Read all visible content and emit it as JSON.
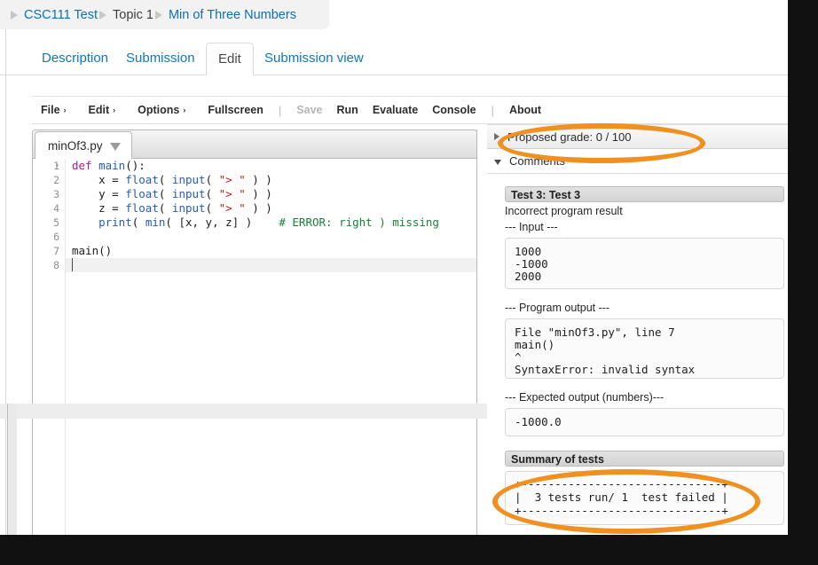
{
  "breadcrumb": {
    "items": [
      {
        "label": "CSC111 Test",
        "type": "link"
      },
      {
        "label": "Topic 1",
        "type": "current"
      },
      {
        "label": "Min of Three Numbers",
        "type": "link"
      }
    ]
  },
  "tabs": [
    {
      "label": "Description",
      "active": false
    },
    {
      "label": "Submission",
      "active": false
    },
    {
      "label": "Edit",
      "active": true
    },
    {
      "label": "Submission view",
      "active": false
    }
  ],
  "toolbar": {
    "file": "File",
    "edit": "Edit",
    "options": "Options",
    "fullscreen": "Fullscreen",
    "separator": "|",
    "save": "Save",
    "run": "Run",
    "evaluate": "Evaluate",
    "console": "Console",
    "separator2": "|",
    "about": "About",
    "caret": "›"
  },
  "editor": {
    "file_tab": "minOf3.py",
    "line_numbers": [
      "1",
      "2",
      "3",
      "4",
      "5",
      "6",
      "7",
      "8"
    ],
    "fold_marker": "▾",
    "code": [
      [
        {
          "t": "def ",
          "c": "kw"
        },
        {
          "t": "main",
          "c": "def"
        },
        {
          "t": "():",
          "c": "pl"
        }
      ],
      [
        {
          "t": "    x = ",
          "c": "pl"
        },
        {
          "t": "float",
          "c": "fn"
        },
        {
          "t": "( ",
          "c": "pl"
        },
        {
          "t": "input",
          "c": "fn"
        },
        {
          "t": "( ",
          "c": "pl"
        },
        {
          "t": "\"> \"",
          "c": "str"
        },
        {
          "t": " ) )",
          "c": "pl"
        }
      ],
      [
        {
          "t": "    y = ",
          "c": "pl"
        },
        {
          "t": "float",
          "c": "fn"
        },
        {
          "t": "( ",
          "c": "pl"
        },
        {
          "t": "input",
          "c": "fn"
        },
        {
          "t": "( ",
          "c": "pl"
        },
        {
          "t": "\"> \"",
          "c": "str"
        },
        {
          "t": " ) )",
          "c": "pl"
        }
      ],
      [
        {
          "t": "    z = ",
          "c": "pl"
        },
        {
          "t": "float",
          "c": "fn"
        },
        {
          "t": "( ",
          "c": "pl"
        },
        {
          "t": "input",
          "c": "fn"
        },
        {
          "t": "( ",
          "c": "pl"
        },
        {
          "t": "\"> \"",
          "c": "str"
        },
        {
          "t": " ) )",
          "c": "pl"
        }
      ],
      [
        {
          "t": "    ",
          "c": "pl"
        },
        {
          "t": "print",
          "c": "fn"
        },
        {
          "t": "( ",
          "c": "pl"
        },
        {
          "t": "min",
          "c": "fn"
        },
        {
          "t": "( [x, y, z] )",
          "c": "pl"
        },
        {
          "t": "    ",
          "c": "pl"
        },
        {
          "t": "# ERROR: right ) missing",
          "c": "com"
        }
      ],
      [],
      [
        {
          "t": "main()",
          "c": "pl"
        }
      ],
      []
    ]
  },
  "right_panel": {
    "proposed_grade": "Proposed grade: 0 / 100",
    "comments_label": "Comments",
    "test_title": "Test 3: Test 3",
    "test_result": "Incorrect program result",
    "input_label": "--- Input ---",
    "input_text": "1000\n-1000\n2000",
    "program_output_label": "--- Program output ---",
    "program_output_text": "File \"minOf3.py\", line 7\nmain()\n^\nSyntaxError: invalid syntax",
    "expected_output_label": "--- Expected output (numbers)---",
    "expected_output_text": "-1000.0",
    "summary_label": "Summary of tests",
    "summary_text": "+------------------------------+\n|  3 tests run/ 1  test failed |\n+------------------------------+"
  },
  "annotations": {
    "highlight_color": "#f0901e",
    "ellipses": [
      {
        "name": "grade-highlight",
        "target": "Proposed grade: 0 / 100"
      },
      {
        "name": "summary-highlight",
        "target": "3 tests run/ 1  test failed"
      }
    ]
  }
}
